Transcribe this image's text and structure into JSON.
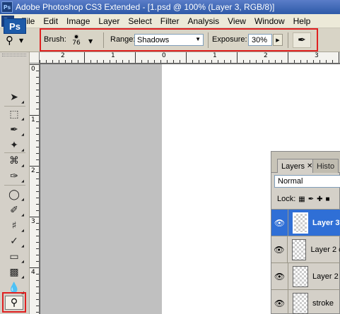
{
  "window": {
    "title": "Adobe Photoshop CS3 Extended - [1.psd @ 100% (Layer 3, RGB/8)]",
    "app_badge": "Ps"
  },
  "menu": {
    "items": [
      "File",
      "Edit",
      "Image",
      "Layer",
      "Select",
      "Filter",
      "Analysis",
      "View",
      "Window",
      "Help"
    ]
  },
  "options": {
    "brush_label": "Brush:",
    "brush_size": "76",
    "range_label": "Range:",
    "range_value": "Shadows",
    "exposure_label": "Exposure:",
    "exposure_value": "30%"
  },
  "toolbox": {
    "logo": "Ps",
    "tools": [
      "move-icon",
      "marquee-icon",
      "lasso-icon",
      "magic-wand-icon",
      "crop-icon",
      "eyedropper-icon",
      "healing-brush-icon",
      "brush-icon",
      "clone-stamp-icon",
      "history-brush-icon",
      "eraser-icon",
      "gradient-icon",
      "blur-icon",
      "burn-icon"
    ],
    "active_tool": "burn-icon"
  },
  "rulers": {
    "h_labels": [
      "2",
      "1",
      "0",
      "1",
      "2",
      "3"
    ],
    "v_labels": [
      "0",
      "1",
      "2",
      "3",
      "4"
    ]
  },
  "layers_panel": {
    "tabs": [
      "Layers",
      "Histo"
    ],
    "blend_mode": "Normal",
    "lock_label": "Lock:",
    "layers": [
      {
        "name": "Layer 3",
        "selected": true
      },
      {
        "name": "Layer 2 c",
        "selected": false
      },
      {
        "name": "Layer 2",
        "selected": false
      },
      {
        "name": "stroke",
        "selected": false
      }
    ]
  },
  "colors": {
    "highlight": "#e02020",
    "selection": "#2f6fd6",
    "canvas_gray": "#c0c0c0"
  }
}
